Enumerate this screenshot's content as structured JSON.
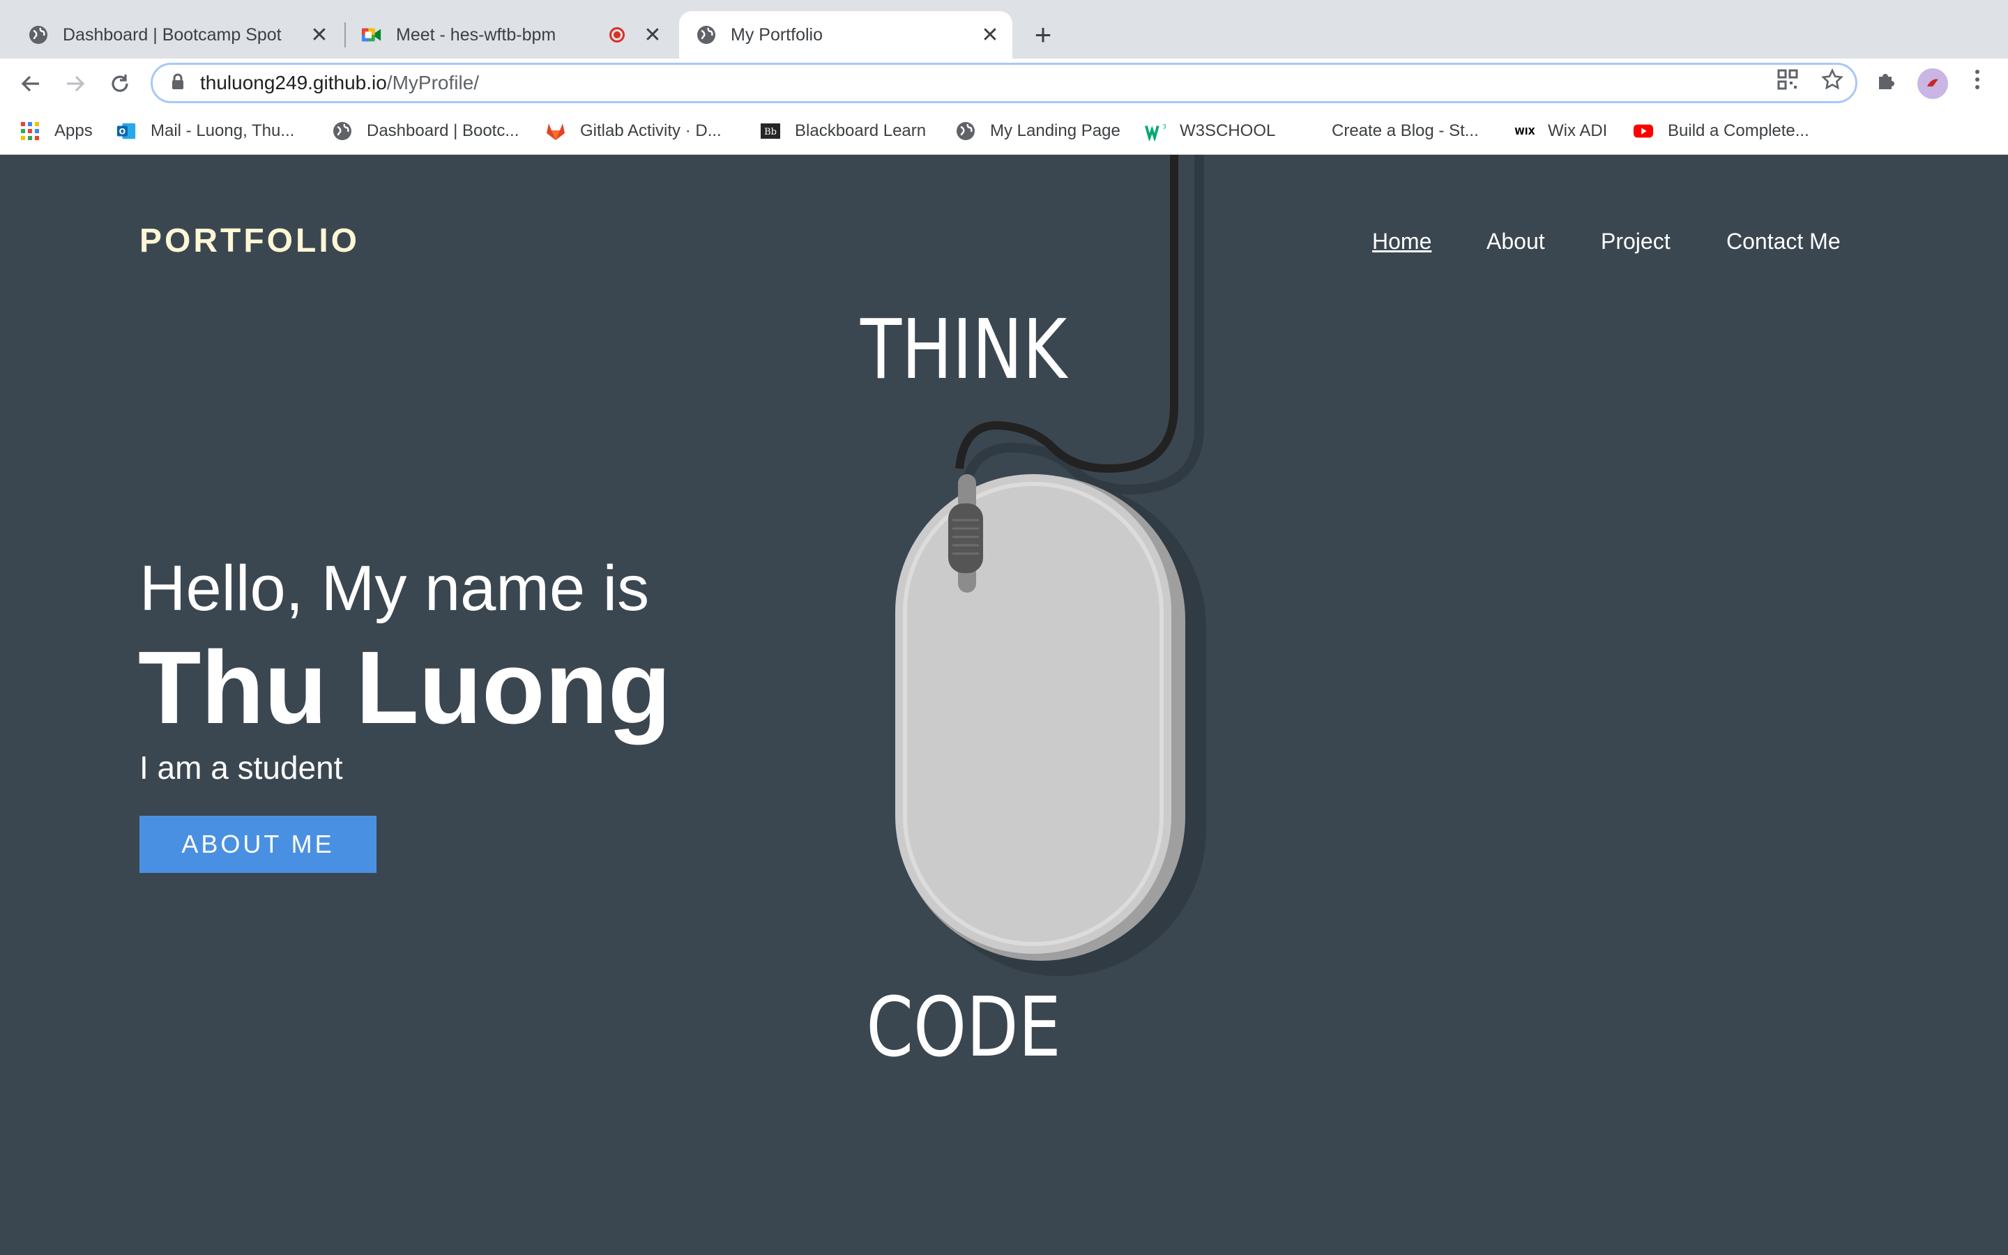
{
  "browser": {
    "tabs": [
      {
        "title": "Dashboard | Bootcamp Spot",
        "favicon": "globe-icon"
      },
      {
        "title": "Meet - hes-wftb-bpm",
        "favicon": "google-meet-icon",
        "recording": true
      },
      {
        "title": "My Portfolio",
        "favicon": "globe-icon",
        "active": true
      }
    ],
    "url_host": "thuluong249.github.io",
    "url_path": "/MyProfile/",
    "bookmarks": [
      {
        "label": "Apps",
        "icon": "apps-grid-icon"
      },
      {
        "label": "Mail - Luong, Thu...",
        "icon": "outlook-icon"
      },
      {
        "label": "Dashboard | Bootc...",
        "icon": "globe-icon"
      },
      {
        "label": "Gitlab Activity · D...",
        "icon": "gitlab-icon"
      },
      {
        "label": "Blackboard Learn",
        "icon": "blackboard-icon"
      },
      {
        "label": "My Landing Page",
        "icon": "globe-icon"
      },
      {
        "label": "W3SCHOOL",
        "icon": "w3schools-icon"
      },
      {
        "label": "Create a Blog - St...",
        "icon": "blank-icon"
      },
      {
        "label": "Wix ADI",
        "icon": "wix-icon"
      },
      {
        "label": "Build a Complete...",
        "icon": "youtube-icon"
      }
    ]
  },
  "site": {
    "logo": "PORTFOLIO",
    "nav": [
      "Home",
      "About",
      "Project",
      "Contact Me"
    ],
    "intro": "Hello, My name is",
    "name": "Thu Luong",
    "role": "I am a student",
    "cta": "ABOUT ME",
    "art_top_text": "THINK",
    "art_bottom_text": "CODE"
  },
  "colors": {
    "page_bg": "#3b4750",
    "logo": "#fff7d6",
    "button": "#4a90e2",
    "mouse_body": "#cbcbcb"
  }
}
